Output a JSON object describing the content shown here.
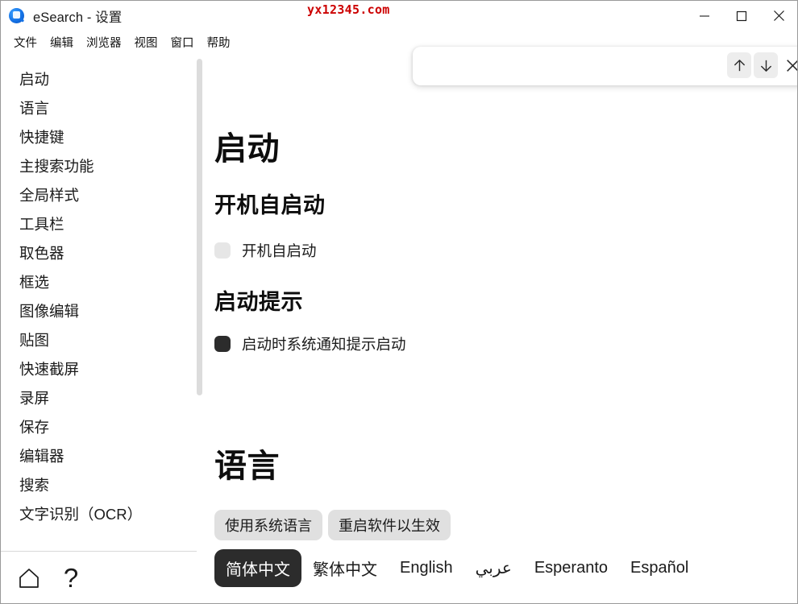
{
  "window": {
    "title": "eSearch - 设置",
    "app_icon": "esearch-logo-icon",
    "watermark": "yx12345.com",
    "controls": {
      "minimize": "minimize-icon",
      "maximize": "maximize-icon",
      "close": "close-icon"
    }
  },
  "menubar": {
    "items": [
      {
        "label": "文件"
      },
      {
        "label": "编辑"
      },
      {
        "label": "浏览器"
      },
      {
        "label": "视图"
      },
      {
        "label": "窗口"
      },
      {
        "label": "帮助"
      }
    ]
  },
  "sidebar": {
    "items": [
      {
        "label": "启动"
      },
      {
        "label": "语言"
      },
      {
        "label": "快捷键"
      },
      {
        "label": "主搜索功能"
      },
      {
        "label": "全局样式"
      },
      {
        "label": "工具栏"
      },
      {
        "label": "取色器"
      },
      {
        "label": "框选"
      },
      {
        "label": "图像编辑"
      },
      {
        "label": "贴图"
      },
      {
        "label": "快速截屏"
      },
      {
        "label": "录屏"
      },
      {
        "label": "保存"
      },
      {
        "label": "编辑器"
      },
      {
        "label": "搜索"
      },
      {
        "label": "文字识别（OCR）"
      }
    ],
    "footer": {
      "home_icon": "home-icon",
      "help_icon": "question-mark-icon",
      "help_glyph": "?"
    }
  },
  "findbar": {
    "value": "",
    "placeholder": "",
    "prev_icon": "arrow-up-icon",
    "next_icon": "arrow-down-icon",
    "close_icon": "close-icon"
  },
  "main": {
    "startup": {
      "title": "启动",
      "autostart": {
        "heading": "开机自启动",
        "checkbox_label": "开机自启动",
        "checked": false
      },
      "notify": {
        "heading": "启动提示",
        "checkbox_label": "启动时系统通知提示启动",
        "checked": true
      }
    },
    "language": {
      "title": "语言",
      "buttons": [
        {
          "label": "使用系统语言"
        },
        {
          "label": "重启软件以生效"
        }
      ],
      "options": [
        {
          "label": "简体中文",
          "selected": true
        },
        {
          "label": "繁体中文",
          "selected": false
        },
        {
          "label": "English",
          "selected": false
        },
        {
          "label": "عربي",
          "selected": false
        },
        {
          "label": "Esperanto",
          "selected": false
        },
        {
          "label": "Español",
          "selected": false
        }
      ]
    }
  },
  "colors": {
    "accent_dark": "#2c2c2c",
    "checkbox_off": "#e6e6e6",
    "pill_bg": "#e0e0e0",
    "watermark_red": "#cc0000",
    "logo_blue": "#1472e6"
  }
}
